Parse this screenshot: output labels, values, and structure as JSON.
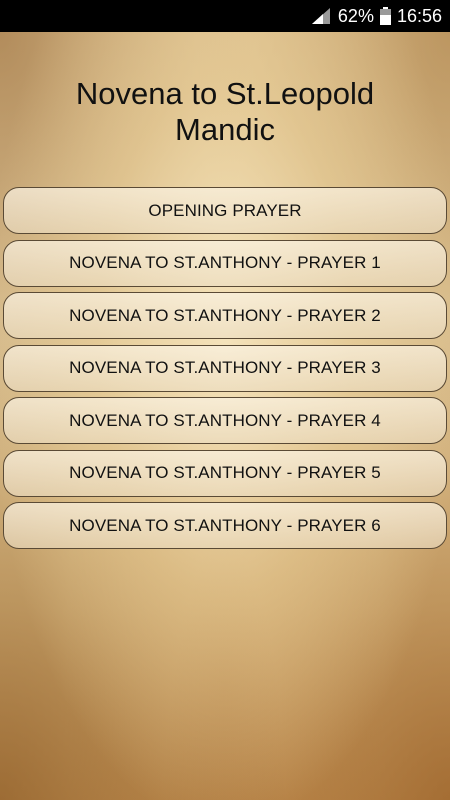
{
  "status_bar": {
    "battery": "62%",
    "time": "16:56",
    "icons": [
      "signal-icon",
      "battery-icon"
    ]
  },
  "page": {
    "title_line1": "Novena to St.Leopold",
    "title_line2": "Mandic"
  },
  "menu": {
    "items": [
      {
        "label": "OPENING PRAYER"
      },
      {
        "label": "NOVENA TO ST.ANTHONY - PRAYER 1"
      },
      {
        "label": "NOVENA TO ST.ANTHONY - PRAYER 2"
      },
      {
        "label": "NOVENA TO ST.ANTHONY - PRAYER 3"
      },
      {
        "label": "NOVENA TO ST.ANTHONY - PRAYER 4"
      },
      {
        "label": "NOVENA TO ST.ANTHONY - PRAYER 5"
      },
      {
        "label": "NOVENA TO ST.ANTHONY - PRAYER 6"
      }
    ]
  }
}
